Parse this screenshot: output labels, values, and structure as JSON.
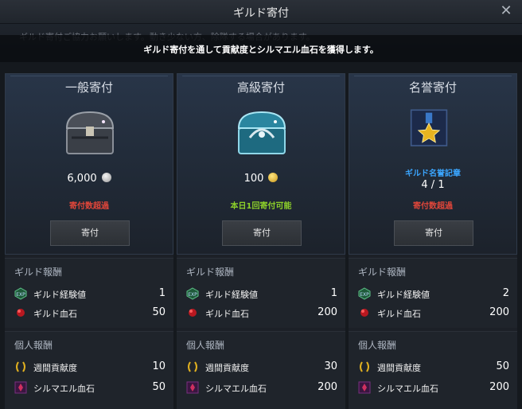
{
  "window": {
    "title": "ギルド寄付",
    "subtitle": "ギルド寄付を通して貢献度とシルマエル血石を獲得します。",
    "background_notice": "ギルド寄付ご協力お願いします。動き少ない方、除隊する場合があります。"
  },
  "cards": [
    {
      "name": "一般寄付",
      "cost": "6,000",
      "status": "寄付数超過",
      "button": "寄付",
      "guild_section": "ギルド報酬",
      "personal_section": "個人報酬",
      "guild_rewards": [
        {
          "label": "ギルド経験値",
          "value": "1"
        },
        {
          "label": "ギルド血石",
          "value": "50"
        }
      ],
      "personal_rewards": [
        {
          "label": "週間貢献度",
          "value": "10"
        },
        {
          "label": "シルマエル血石",
          "value": "50"
        }
      ]
    },
    {
      "name": "高級寄付",
      "cost": "100",
      "status": "本日1回寄付可能",
      "button": "寄付",
      "guild_section": "ギルド報酬",
      "personal_section": "個人報酬",
      "guild_rewards": [
        {
          "label": "ギルド経験値",
          "value": "1"
        },
        {
          "label": "ギルド血石",
          "value": "200"
        }
      ],
      "personal_rewards": [
        {
          "label": "週間貢献度",
          "value": "30"
        },
        {
          "label": "シルマエル血石",
          "value": "200"
        }
      ]
    },
    {
      "name": "名誉寄付",
      "medal_name": "ギルド名誉記章",
      "medal_count": "4 / 1",
      "status": "寄付数超過",
      "button": "寄付",
      "guild_section": "ギルド報酬",
      "personal_section": "個人報酬",
      "guild_rewards": [
        {
          "label": "ギルド経験値",
          "value": "2"
        },
        {
          "label": "ギルド血石",
          "value": "200"
        }
      ],
      "personal_rewards": [
        {
          "label": "週間貢献度",
          "value": "50"
        },
        {
          "label": "シルマエル血石",
          "value": "200"
        }
      ]
    }
  ],
  "colors": {
    "status_exceeded": "#e0463a",
    "status_available": "#8ccf2a",
    "medal_name": "#3ba6ff"
  },
  "icons": {
    "cost_normal": "silver-coin-icon",
    "cost_premium": "gold-coin-icon",
    "guild_exp": "guild-exp-icon",
    "guild_bloodstone": "red-gem-icon",
    "weekly_contribution": "laurel-icon",
    "silmael_bloodstone": "purple-crystal-icon"
  }
}
